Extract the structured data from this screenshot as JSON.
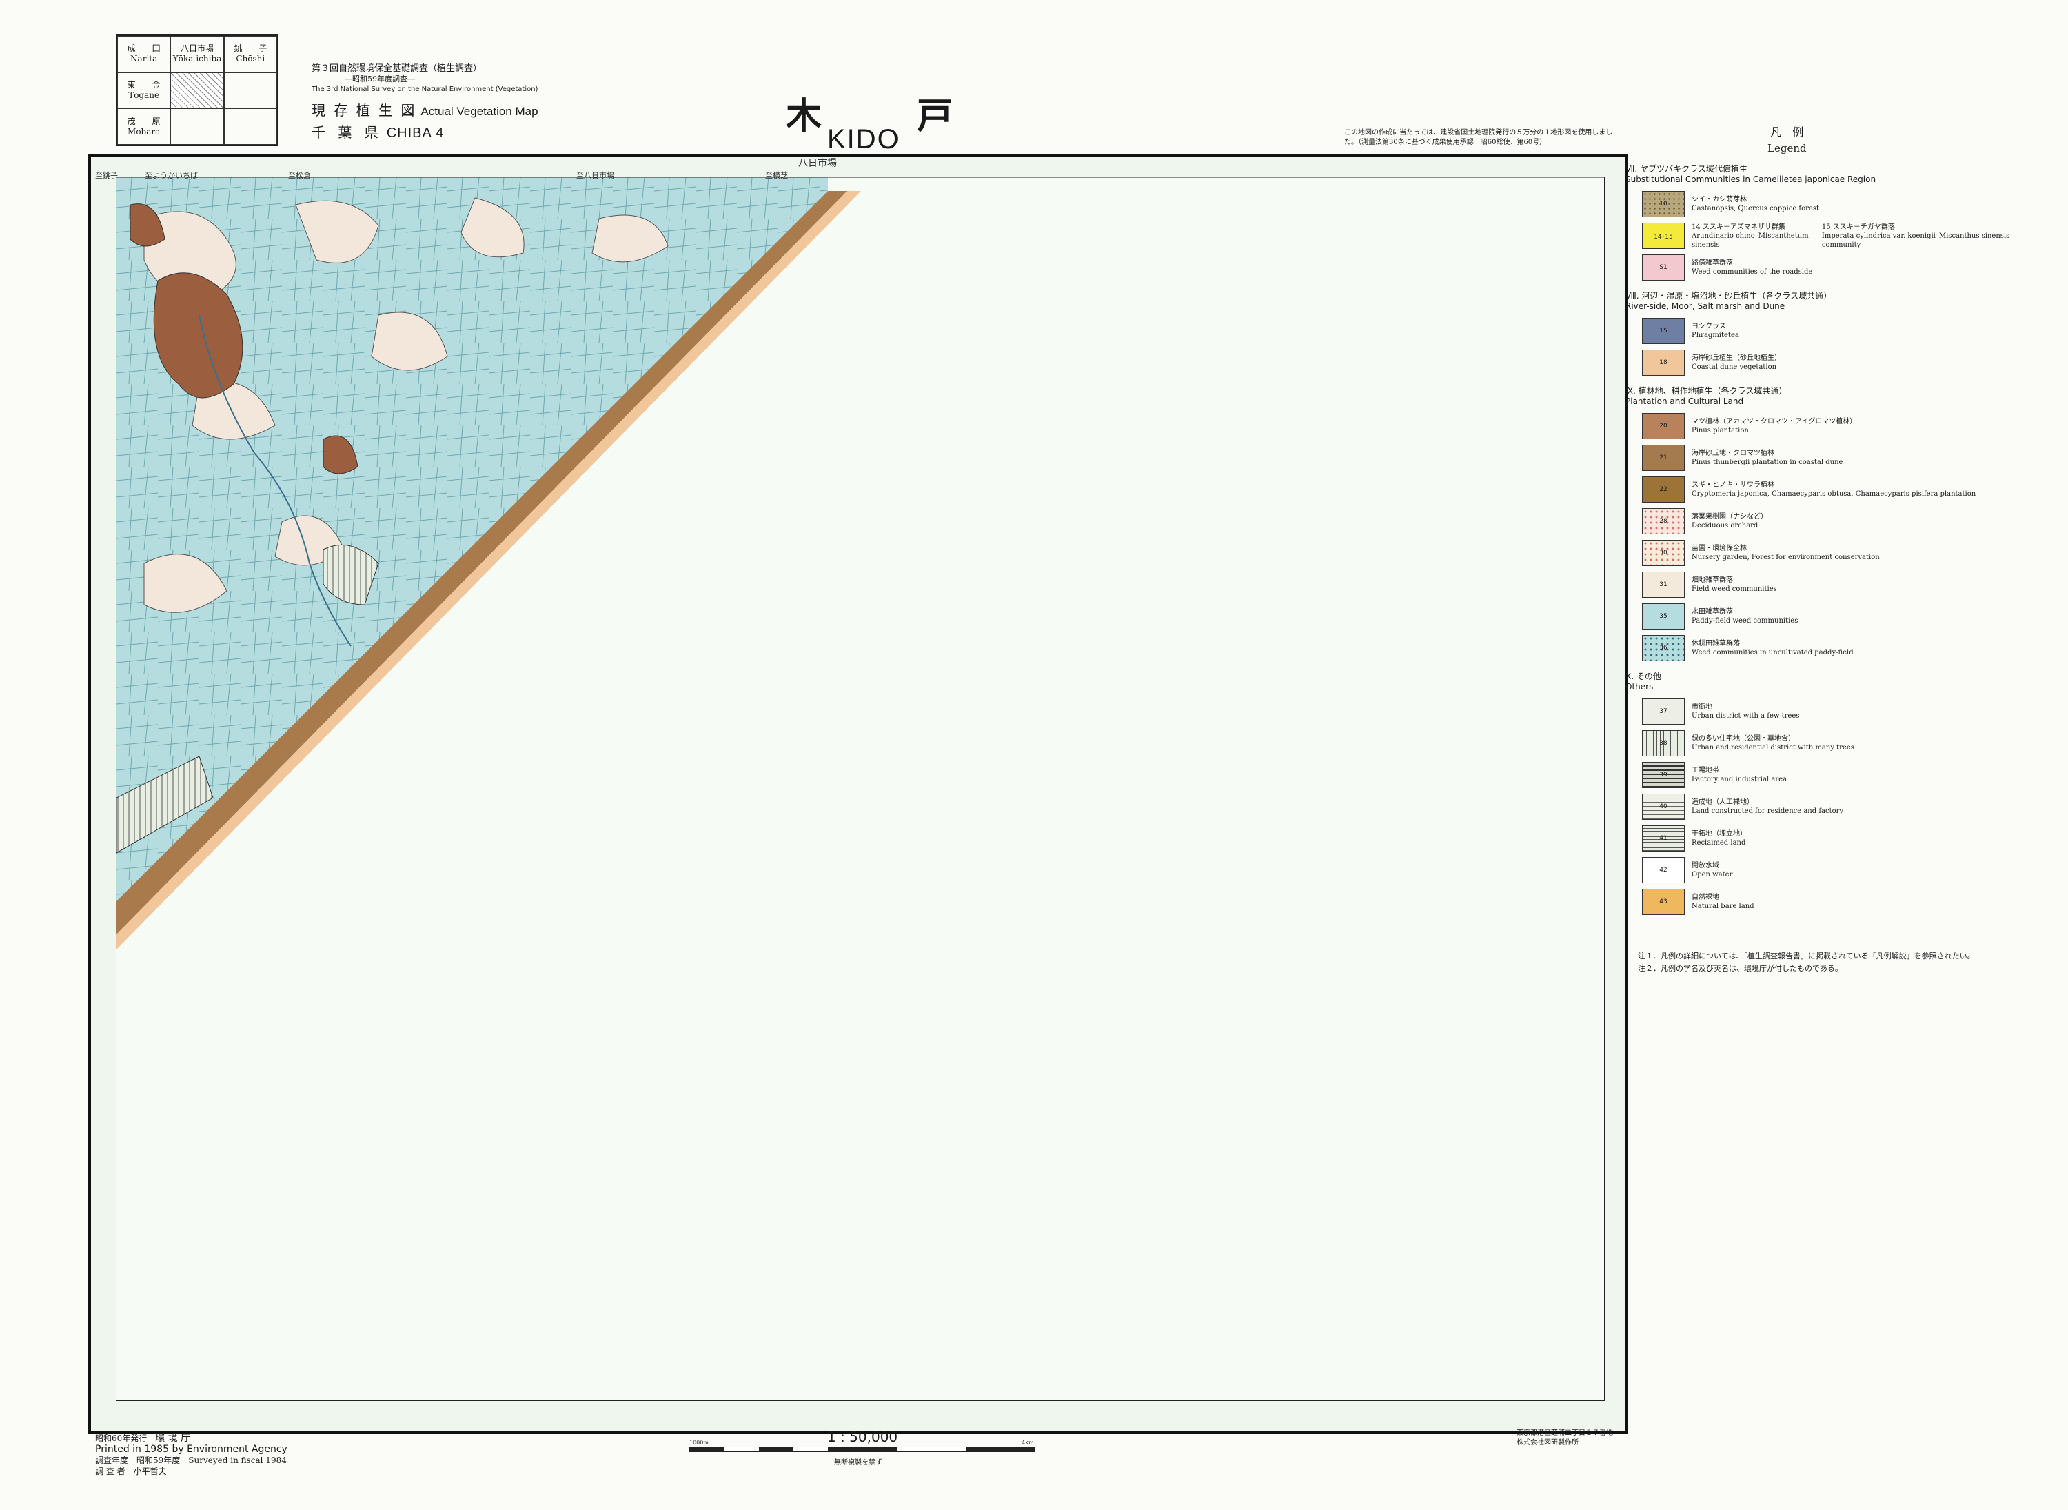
{
  "index_grid": [
    {
      "jp": "成　　田",
      "en": "Narita"
    },
    {
      "jp": "八日市場",
      "en": "Yōka-ichiba"
    },
    {
      "jp": "銚　　子",
      "en": "Chōshi"
    },
    {
      "jp": "東　　金",
      "en": "Tōgane"
    },
    {
      "jp": "",
      "en": "",
      "current": true
    },
    {
      "jp": "",
      "en": ""
    },
    {
      "jp": "茂　　原",
      "en": "Mobara"
    },
    {
      "jp": "",
      "en": ""
    },
    {
      "jp": "",
      "en": ""
    }
  ],
  "header": {
    "survey_title": "第３回自然環境保全基礎調査（植生調査）",
    "survey_sub": "―昭和59年度調査―",
    "survey_en": "The 3rd National Survey on the Natural Environment (Vegetation)",
    "map_type_jp": "現 存 植 生 図",
    "map_type_en": "Actual Vegetation Map",
    "sheet_jp": "千 葉 県",
    "sheet_en": "CHIBA 4",
    "title_jp": "木 戸",
    "title_en": "KIDO",
    "note": "この地図の作成に当たっては、建設省国土地理院発行の５万分の１地形図を使用しました。（測量法第30条に基づく成果使用承認　昭60総使、第60号）"
  },
  "map_labels": {
    "top_center": "八日市場",
    "top_1": "至銚子",
    "top_2": "至ようかいちば",
    "top_3": "至松倉",
    "top_4": "至八日市場",
    "top_5": "至横芝"
  },
  "legend": {
    "title_jp": "凡　例",
    "title_en": "Legend",
    "sections": [
      {
        "jp": "Ⅶ. ヤブツバキクラス域代償植生",
        "en": "Substitutional Communities in Camellietea japonicae Region",
        "items": [
          {
            "code": "10",
            "jp": "シイ・カシ萌芽林",
            "en": "Castanopsis, Quercus coppice forest",
            "color": "#b8a67c",
            "pattern": "dots"
          },
          {
            "code": "14･15",
            "jp": "14 ススキ－アズマネザサ群集",
            "en": "Arundinario chino–Miscanthetum sinensis",
            "color": "#f3ea3c",
            "pattern": "none",
            "extra_jp": "15 ススキ－チガヤ群落",
            "extra_en": "Imperata cylindrica var. koenigii–Miscanthus sinensis community"
          },
          {
            "code": "S1",
            "jp": "路傍雑草群落",
            "en": "Weed communities of the roadside",
            "color": "#f4c8cf",
            "pattern": "none"
          }
        ]
      },
      {
        "jp": "Ⅷ. 河辺・湿原・塩沼地・砂丘植生（各クラス域共通）",
        "en": "River-side, Moor, Salt marsh and Dune",
        "items": [
          {
            "code": "15",
            "jp": "ヨシクラス",
            "en": "Phragmitetea",
            "color": "#6f7fa3",
            "pattern": "none"
          },
          {
            "code": "18",
            "jp": "海岸砂丘植生（砂丘地植生）",
            "en": "Coastal dune vegetation",
            "color": "#f0c69a",
            "pattern": "none"
          }
        ]
      },
      {
        "jp": "Ⅸ. 植林地、耕作地植生（各クラス域共通）",
        "en": "Plantation and Cultural Land",
        "items": [
          {
            "code": "20",
            "jp": "マツ植林（アカマツ・クロマツ・アイグロマツ植林）",
            "en": "Pinus plantation",
            "color": "#b9825a",
            "pattern": "none"
          },
          {
            "code": "21",
            "jp": "海岸砂丘地・クロマツ植林",
            "en": "Pinus thunbergii plantation in coastal dune",
            "color": "#a37b4e",
            "pattern": "none"
          },
          {
            "code": "22",
            "jp": "スギ・ヒノキ・サワラ植林",
            "en": "Cryptomeria japonica, Chamaecyparis obtusa, Chamaecyparis pisifera plantation",
            "color": "#9c7437",
            "pattern": "none"
          },
          {
            "code": "28",
            "jp": "落葉果樹園（ナシなど）",
            "en": "Deciduous orchard",
            "color": "#f9e6dc",
            "pattern": "dots-red"
          },
          {
            "code": "30",
            "jp": "苗圃・環境保全林",
            "en": "Nursery garden, Forest for environment conservation",
            "color": "#f8ecd8",
            "pattern": "dots-red"
          },
          {
            "code": "31",
            "jp": "畑地雑草群落",
            "en": "Field weed communities",
            "color": "#f3eadc",
            "pattern": "none"
          },
          {
            "code": "35",
            "jp": "水田雑草群落",
            "en": "Paddy-field weed communities",
            "color": "#b5dde0",
            "pattern": "none"
          },
          {
            "code": "36",
            "jp": "休耕田雑草群落",
            "en": "Weed communities in uncultivated paddy-field",
            "color": "#b5dde0",
            "pattern": "dots-dark"
          }
        ]
      },
      {
        "jp": "Ⅹ. その他",
        "en": "Others",
        "items": [
          {
            "code": "37",
            "jp": "市街地",
            "en": "Urban district with a few trees",
            "color": "#edeee6",
            "pattern": "none"
          },
          {
            "code": "38",
            "jp": "緑の多い住宅地（公園・墓地含）",
            "en": "Urban and residential district with many trees",
            "color": "#e9eee2",
            "pattern": "vlines"
          },
          {
            "code": "39",
            "jp": "工場地帯",
            "en": "Factory and industrial area",
            "color": "#d5d8cd",
            "pattern": "hlines-thick"
          },
          {
            "code": "40",
            "jp": "造成地（人工裸地）",
            "en": "Land constructed for residence and factory",
            "color": "#eef0e6",
            "pattern": "hlines"
          },
          {
            "code": "41",
            "jp": "干拓地（埋立地）",
            "en": "Reclaimed land",
            "color": "#e8ede2",
            "pattern": "hlines-dense"
          },
          {
            "code": "42",
            "jp": "開放水域",
            "en": "Open water",
            "color": "#ffffff",
            "pattern": "none"
          },
          {
            "code": "43",
            "jp": "自然裸地",
            "en": "Natural bare land",
            "color": "#f0b85e",
            "pattern": "none"
          }
        ]
      }
    ],
    "notes": [
      "注１．凡例の詳細については、「植生調査報告書」に掲載されている「凡例解説」を参照されたい。",
      "注２．凡例の学名及び英名は、環境庁が付したものである。"
    ]
  },
  "footer": {
    "issued_jp": "昭和60年発行",
    "agency_jp": "環 境 庁",
    "printed_en": "Printed in 1985 by Environment Agency",
    "survey_year_jp": "調査年度　昭和59年度",
    "survey_year_en": "Surveyed in fiscal 1984",
    "surveyor": "調 査 者　小平哲夫",
    "scale": "1 : 50,000",
    "scale_left": "1000m",
    "scale_right": "4km",
    "scale_caption": "無断複製を禁ず",
    "printer_1": "東京都港区芝浦二丁目２７番地",
    "printer_2": "株式会社図研製作所"
  },
  "colors": {
    "paddy": "#b5dde0",
    "field": "#f2e7da",
    "coast_pine": "#a87a4c",
    "pine": "#9b5f3f",
    "sea": "#f6fbf6"
  }
}
